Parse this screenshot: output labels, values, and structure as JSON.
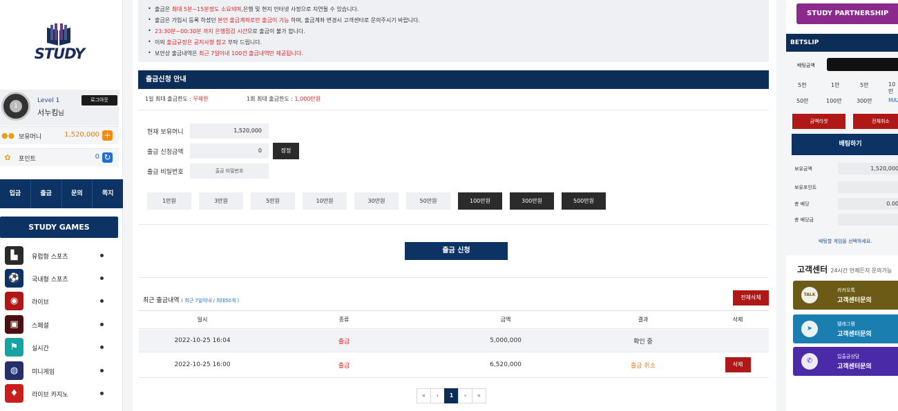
{
  "brand": {
    "logo_text": "STUDY"
  },
  "profile": {
    "level": "Level 1",
    "level_badge": "1",
    "username": "서누킹",
    "suffix": "님",
    "logout_label": "로그아웃"
  },
  "balances": [
    {
      "label": "보유머니",
      "value": "1,520,000",
      "icon": "coin-icon",
      "action": "+",
      "color": "#e07b16"
    },
    {
      "label": "포인트",
      "value": "0",
      "icon": "point-icon",
      "action": "↻",
      "color": "#1f6fd1"
    }
  ],
  "top_nav": [
    "입금",
    "출금",
    "문의",
    "쪽지"
  ],
  "games_title": "STUDY GAMES",
  "games": [
    {
      "label": "유럽형 스포츠",
      "icon": "european-sports-icon",
      "color": "#2a2a2a",
      "glyph": "▙"
    },
    {
      "label": "국내형 스포츠",
      "icon": "korean-sports-icon",
      "color": "#0c3364",
      "glyph": "⚽"
    },
    {
      "label": "라이브",
      "icon": "live-icon",
      "color": "#b01818",
      "glyph": "◉"
    },
    {
      "label": "스페셜",
      "icon": "special-icon",
      "color": "#4a1010",
      "glyph": "▣"
    },
    {
      "label": "실시간",
      "icon": "realtime-icon",
      "color": "#18a3a3",
      "glyph": "⚑"
    },
    {
      "label": "미니게임",
      "icon": "minigame-icon",
      "color": "#25306b",
      "glyph": "◍"
    },
    {
      "label": "라이브 카지노",
      "icon": "live-casino-icon",
      "color": "#c81e1e",
      "glyph": "♦"
    }
  ],
  "notices": [
    [
      {
        "t": "출금은 "
      },
      {
        "t": "최대 5분~15분정도 소요되며,",
        "red": true
      },
      {
        "t": "은행 및 현지 인터넷 사정으로 지연될 수 있습니다."
      }
    ],
    [
      {
        "t": "출금은 가입시 등록 하셨던 "
      },
      {
        "t": "본인 출금계좌로만 출금이 가능",
        "red": true
      },
      {
        "t": " 하며, 출금계좌 변경시 고객센터로 문의주시기 바랍니다."
      }
    ],
    [
      {
        "t": "23:30분~00:30분 까지 은행점검 시간",
        "red": true
      },
      {
        "t": "으로 출금이 불가 합니다."
      }
    ],
    [
      {
        "t": "이외 "
      },
      {
        "t": "출금규정은 공지사항 참고",
        "red": true
      },
      {
        "t": " 부탁 드립니다."
      }
    ],
    [
      {
        "t": "보안상 출금내역은 "
      },
      {
        "t": "최근 7일이내 100건 출금내역만 제공됩니다.",
        "red": true
      }
    ]
  ],
  "withdraw": {
    "section_title": "출금신청 안내",
    "daily_limit_label": "1일 최대 출금한도 : ",
    "daily_limit_value": "무제한",
    "single_limit_label": "1회 최대 출금한도 : ",
    "single_limit_value": "1,000만원",
    "current_money_label": "현재 보유머니",
    "current_money_value": "1,520,000",
    "amount_label": "출금 신청금액",
    "amount_value": "0",
    "reset_label": "정정",
    "password_label": "출금 비밀번호",
    "password_placeholder": "출금 비밀번호",
    "amount_buttons": [
      {
        "label": "1만원",
        "dark": false
      },
      {
        "label": "3만원",
        "dark": false
      },
      {
        "label": "5만원",
        "dark": false
      },
      {
        "label": "10만원",
        "dark": false
      },
      {
        "label": "30만원",
        "dark": false
      },
      {
        "label": "50만원",
        "dark": false
      },
      {
        "label": "100만원",
        "dark": true
      },
      {
        "label": "300만원",
        "dark": true
      },
      {
        "label": "500만원",
        "dark": true
      }
    ],
    "submit_label": "출금 신청"
  },
  "history": {
    "title": "최근 출금내역",
    "subtitle": "( 최근 7일이내 / 최대50개 )",
    "delete_all_label": "전체삭제",
    "columns": [
      "일시",
      "종류",
      "금액",
      "결과",
      "삭제"
    ],
    "rows": [
      {
        "date": "2022-10-25 16:04",
        "type": "출금",
        "amount": "5,000,000",
        "result": "확인 중",
        "cancelled": false,
        "deletable": false
      },
      {
        "date": "2022-10-25 16:00",
        "type": "출금",
        "amount": "6,520,000",
        "result": "출금 취소",
        "cancelled": true,
        "deletable": true
      }
    ],
    "delete_label": "삭제"
  },
  "pagination": {
    "first": "«",
    "prev": "‹",
    "current": "1",
    "next": "›",
    "last": "»"
  },
  "betslip": {
    "partnership_label": "STUDY PARTNERSHIP",
    "title": "BETSLIP",
    "bet_amount_label": "배팅금액",
    "chips_row1": [
      "5천",
      "1만",
      "5만",
      "10만"
    ],
    "chips_row2": [
      "50만",
      "100만",
      "300만",
      "MAX"
    ],
    "reset_label": "금액리셋",
    "cancel_all_label": "전체취소",
    "bet_button_label": "배팅하기",
    "stats": [
      {
        "label": "보유금액",
        "value": "1,520,000"
      },
      {
        "label": "보유포인트",
        "value": ""
      },
      {
        "label": "총 배당",
        "value": "0.00"
      },
      {
        "label": "총 배당금",
        "value": ""
      }
    ],
    "hint": "배팅할 게임을 선택하세요."
  },
  "support": {
    "title": "고객센터",
    "subtitle": "24시간 언제든지 문의가능",
    "items": [
      {
        "line1": "카카오톡",
        "line2": "고객센터문의",
        "icon": "kakaotalk-icon",
        "glyph": "TALK",
        "color": "#6b5b17"
      },
      {
        "line1": "텔레그램",
        "line2": "고객센터문의",
        "icon": "telegram-icon",
        "glyph": "➤",
        "color": "#1a7fb0"
      },
      {
        "line1": "입출금상담",
        "line2": "고객센터문의",
        "icon": "phone-icon",
        "glyph": "✆",
        "color": "#4b2aa8"
      }
    ]
  }
}
